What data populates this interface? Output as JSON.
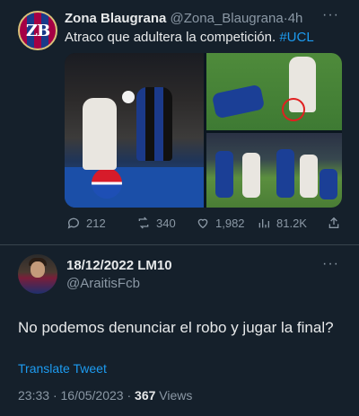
{
  "tweet1": {
    "avatar_text": "ZB",
    "author_name": "Zona Blaugrana",
    "author_handle": "@Zona_Blaugrana",
    "separator": "·",
    "time": "4h",
    "text": "Atraco que adultera la competición.",
    "hashtag": "#UCL",
    "more_icon": "more-dots-icon",
    "media_count": 3,
    "actions": {
      "replies": "212",
      "retweets": "340",
      "likes": "1,982",
      "views": "81.2K"
    }
  },
  "tweet2": {
    "author_name": "18/12/2022 LM10",
    "author_handle": "@AraitisFcb",
    "more_icon": "more-dots-icon",
    "text": "No podemos denunciar el robo y jugar la final?",
    "translate_label": "Translate Tweet",
    "time": "23:33",
    "dot": "·",
    "date": "16/05/2023",
    "view_count": "367",
    "views_label": "Views"
  },
  "colors": {
    "background": "#15202b",
    "text": "#e7e9ea",
    "secondary": "#8b98a5",
    "link": "#1d9bf0",
    "divider": "#38444d"
  }
}
